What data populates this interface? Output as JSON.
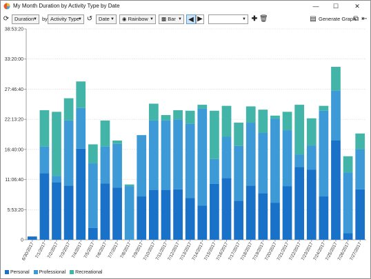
{
  "window": {
    "title": "My Month Duration by Activity Type by Date",
    "minimize_glyph": "—",
    "maximize_glyph": "☐",
    "close_glyph": "✕"
  },
  "toolbar": {
    "measure": "Duration",
    "by_label": "by",
    "group": "Activity Type",
    "axis": "Date",
    "palette": "Rainbow",
    "chart_type": "Bar",
    "filter_value": "",
    "generate_label": "Generate Graph",
    "icons": [
      "refresh-icon",
      "swap-axes-icon",
      "palette-icon",
      "bar-chart-icon",
      "stacked-left-icon",
      "stacked-right-icon",
      "add-icon",
      "delete-icon",
      "generate-graph-icon",
      "copy-icon",
      "export-icon"
    ]
  },
  "colors": {
    "Personal": "#1a72c8",
    "Professional": "#3d9ad6",
    "Recreational": "#43b5a8",
    "axis": "#888888",
    "grid": "#cccccc"
  },
  "chart_data": {
    "type": "bar",
    "stacked": true,
    "ylim": [
      0,
      38.889
    ],
    "ytick_labels": [
      "0",
      "5:53:20",
      "11:06:40",
      "16:40:00",
      "22:13:20",
      "27:46:40",
      "33:20:00",
      "38:53:20"
    ],
    "ytick_values_hours": [
      0,
      5.556,
      11.111,
      16.667,
      22.222,
      27.778,
      33.333,
      38.889
    ],
    "grid": true,
    "legend_position": "bottom-left",
    "categories": [
      "6/30/2017",
      "7/1/2017",
      "7/2/2017",
      "7/3/2017",
      "7/4/2017",
      "7/5/2017",
      "7/6/2017",
      "7/7/2017",
      "7/8/2017",
      "7/9/2017",
      "7/10/2017",
      "7/11/2017",
      "7/12/2017",
      "7/13/2017",
      "7/14/2017",
      "7/15/2017",
      "7/16/2017",
      "7/17/2017",
      "7/18/2017",
      "7/19/2017",
      "7/20/2017",
      "7/21/2017",
      "7/22/2017",
      "7/23/2017",
      "7/24/2017",
      "7/25/2017",
      "7/26/2017",
      "7/27/2017"
    ],
    "series": [
      {
        "name": "Personal",
        "values": [
          0.6,
          12.3,
          10.6,
          10.0,
          16.8,
          2.2,
          10.4,
          9.6,
          0,
          8.0,
          9.2,
          9.2,
          9.3,
          7.7,
          6.3,
          10.3,
          11.4,
          7.2,
          10.0,
          8.6,
          6.8,
          9.9,
          13.4,
          12.9,
          8.0,
          18.3,
          1.2,
          9.3
        ]
      },
      {
        "name": "Professional",
        "values": [
          0,
          4.9,
          1.2,
          12.0,
          7.5,
          11.9,
          6.8,
          8.1,
          9.9,
          11.3,
          12.8,
          12.8,
          12.9,
          13.7,
          17.9,
          4.6,
          7.6,
          10.1,
          11.6,
          11.1,
          15.5,
          10.3,
          2.3,
          4.5,
          15.8,
          9.2,
          11.2,
          7.4
        ]
      },
      {
        "name": "Recreational",
        "values": [
          0,
          6.7,
          11.8,
          4.1,
          4.9,
          3.5,
          4.8,
          0.6,
          0.3,
          0,
          3.1,
          1.0,
          1.7,
          2.4,
          0.7,
          8.9,
          5.7,
          4.3,
          3.0,
          4.3,
          0.6,
          3.4,
          9.2,
          5.0,
          0.9,
          4.4,
          3.0,
          2.9
        ]
      }
    ]
  }
}
